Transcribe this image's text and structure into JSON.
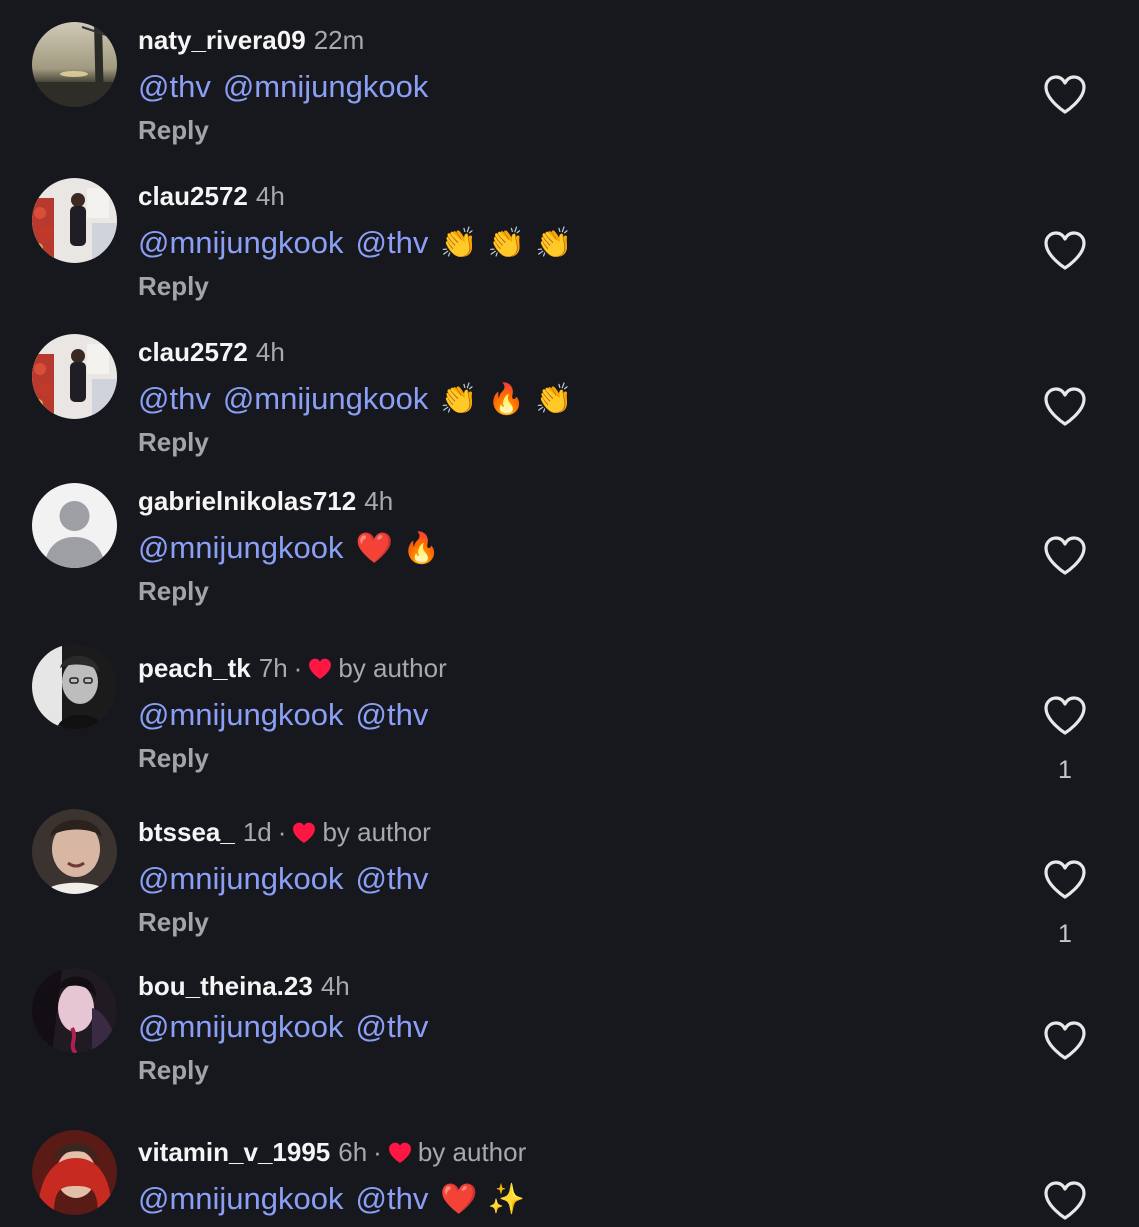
{
  "reply_label": "Reply",
  "by_author_label": "by author",
  "meta_separator": "·",
  "colors": {
    "background": "#16181d",
    "mention": "#8a9ff5",
    "muted": "#a8a9ad",
    "author_heart": "#ff1744"
  },
  "comments": [
    {
      "username": "naty_rivera09",
      "time": "22m",
      "mentions": [
        "@thv",
        "@mnijungkook"
      ],
      "emojis": [],
      "liked_by_author": false,
      "like_count": "",
      "avatar_icon": "sunset-photo-avatar"
    },
    {
      "username": "clau2572",
      "time": "4h",
      "mentions": [
        "@mnijungkook",
        "@thv"
      ],
      "emojis": [
        "👏",
        "👏",
        "👏"
      ],
      "liked_by_author": false,
      "like_count": "",
      "avatar_icon": "person-photo-avatar"
    },
    {
      "username": "clau2572",
      "time": "4h",
      "mentions": [
        "@thv",
        "@mnijungkook"
      ],
      "emojis": [
        "👏",
        "🔥",
        "👏"
      ],
      "liked_by_author": false,
      "like_count": "",
      "avatar_icon": "person-photo-avatar"
    },
    {
      "username": "gabrielnikolas712",
      "time": "4h",
      "mentions": [
        "@mnijungkook"
      ],
      "emojis": [
        "❤️",
        "🔥"
      ],
      "liked_by_author": false,
      "like_count": "",
      "avatar_icon": "default-avatar"
    },
    {
      "username": "peach_tk",
      "time": "7h",
      "mentions": [
        "@mnijungkook",
        "@thv"
      ],
      "emojis": [],
      "liked_by_author": true,
      "like_count": "1",
      "avatar_icon": "bw-portrait-avatar"
    },
    {
      "username": "btssea_",
      "time": "1d",
      "mentions": [
        "@mnijungkook",
        "@thv"
      ],
      "emojis": [],
      "liked_by_author": true,
      "like_count": "1",
      "avatar_icon": "face-photo-avatar"
    },
    {
      "username": "bou_theina.23",
      "time": "4h",
      "mentions": [
        "@mnijungkook",
        "@thv"
      ],
      "emojis": [],
      "liked_by_author": false,
      "like_count": "",
      "avatar_icon": "art-avatar"
    },
    {
      "username": "vitamin_v_1995",
      "time": "6h",
      "mentions": [
        "@mnijungkook",
        "@thv"
      ],
      "emojis": [
        "❤️",
        "✨"
      ],
      "liked_by_author": true,
      "like_count": "",
      "avatar_icon": "red-hood-avatar"
    }
  ]
}
